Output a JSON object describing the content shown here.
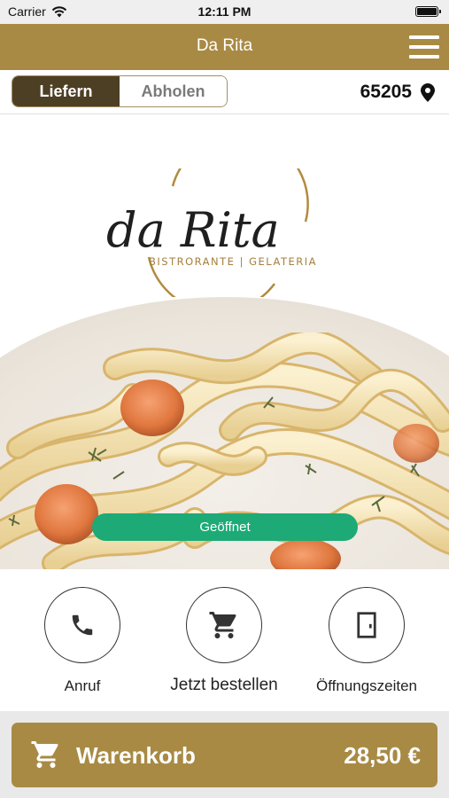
{
  "status_bar": {
    "carrier": "Carrier",
    "time": "12:11 PM",
    "battery_level": 1.0
  },
  "nav": {
    "title": "Da Rita",
    "menu_icon": "hamburger-icon"
  },
  "toolbar": {
    "delivery_label": "Liefern",
    "pickup_label": "Abholen",
    "selected": "Liefern",
    "postcode": "65205",
    "location_icon": "map-pin-icon"
  },
  "logo": {
    "script_text": "da Rita",
    "tagline": "BISTRORANTE | GELATERIA"
  },
  "hero": {
    "status_badge": "Geöffnet"
  },
  "actions": [
    {
      "label": "Anruf",
      "icon": "phone-icon"
    },
    {
      "label": "Jetzt bestellen",
      "icon": "cart-icon"
    },
    {
      "label": "Öffnungszeiten",
      "icon": "door-icon"
    }
  ],
  "cart": {
    "label": "Warenkorb",
    "total": "28,50 €",
    "icon": "cart-icon"
  },
  "colors": {
    "brand": "#a88a44",
    "segment_active": "#4d3f24",
    "open_badge": "#1daa76"
  }
}
